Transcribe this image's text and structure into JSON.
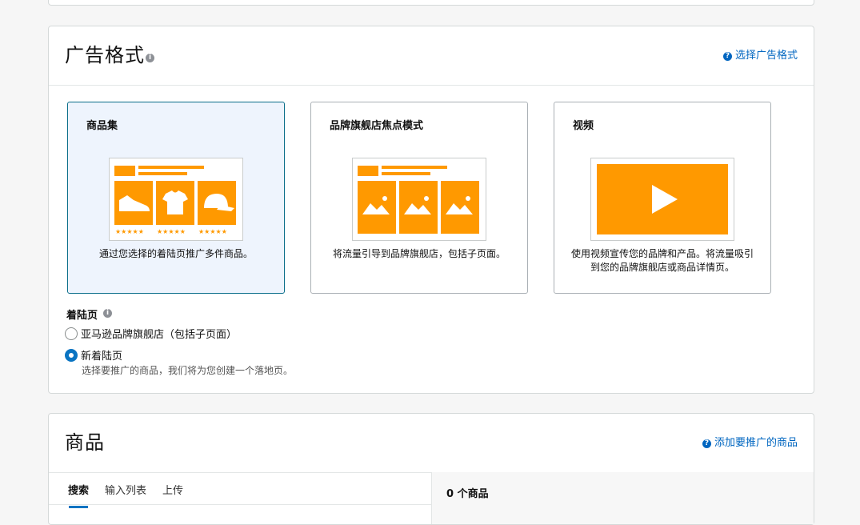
{
  "ad_format": {
    "title": "广告格式",
    "help_link": "选择广告格式",
    "cards": [
      {
        "title": "商品集",
        "description": "通过您选择的着陆页推广多件商品。",
        "selected": true
      },
      {
        "title": "品牌旗舰店焦点模式",
        "description": "将流量引导到品牌旗舰店，包括子页面。",
        "selected": false
      },
      {
        "title": "视频",
        "description_line1": "使用视频宣传您的品牌和产品。将流量吸引",
        "description_line2": "到您的品牌旗舰店或商品详情页。",
        "selected": false
      }
    ],
    "landing_page": {
      "label": "着陆页",
      "options": [
        {
          "label": "亚马逊品牌旗舰店（包括子页面）",
          "checked": false
        },
        {
          "label": "新着陆页",
          "checked": true,
          "help": "选择要推广的商品，我们将为您创建一个落地页。"
        }
      ]
    }
  },
  "products": {
    "title": "商品",
    "help_link": "添加要推广的商品",
    "tabs": [
      "搜索",
      "输入列表",
      "上传"
    ],
    "active_tab": "搜索",
    "count_label": "0 个商品"
  },
  "colors": {
    "accent": "#0a74c2",
    "link": "#0066c0",
    "illustration_orange": "#ff9900"
  },
  "icons": {
    "info": "info-icon",
    "help": "question-circle-icon",
    "sneaker": "sneaker-icon",
    "tshirt": "tshirt-icon",
    "cap": "cap-icon",
    "landscape": "image-placeholder-icon",
    "play": "play-icon"
  }
}
